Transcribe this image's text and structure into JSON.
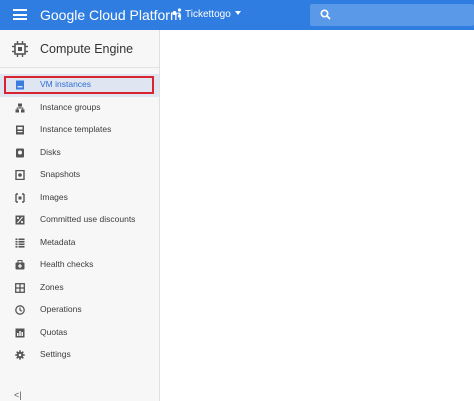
{
  "header": {
    "app_title": "Google Cloud Platform",
    "project_name": "Tickettogo",
    "icons": {
      "menu": "hamburger-menu-icon",
      "project": "project-nodes-icon",
      "dropdown": "caret-down-icon",
      "search": "search-icon"
    },
    "bar_color": "#2f7de1"
  },
  "sidebar": {
    "section_title": "Compute Engine",
    "section_icon": "chip-icon",
    "items": [
      {
        "label": "VM instances",
        "icon": "vm-instance-icon",
        "active": true
      },
      {
        "label": "Instance groups",
        "icon": "instance-groups-icon"
      },
      {
        "label": "Instance templates",
        "icon": "instance-templates-icon"
      },
      {
        "label": "Disks",
        "icon": "disk-icon"
      },
      {
        "label": "Snapshots",
        "icon": "snapshot-icon"
      },
      {
        "label": "Images",
        "icon": "images-icon"
      },
      {
        "label": "Committed use discounts",
        "icon": "percent-icon"
      },
      {
        "label": "Metadata",
        "icon": "metadata-icon"
      },
      {
        "label": "Health checks",
        "icon": "health-check-icon"
      },
      {
        "label": "Zones",
        "icon": "zones-icon"
      },
      {
        "label": "Operations",
        "icon": "clock-icon"
      },
      {
        "label": "Quotas",
        "icon": "quotas-icon"
      },
      {
        "label": "Settings",
        "icon": "gear-icon"
      }
    ],
    "collapse_label": "<|",
    "highlight_color": "#d9232e"
  }
}
